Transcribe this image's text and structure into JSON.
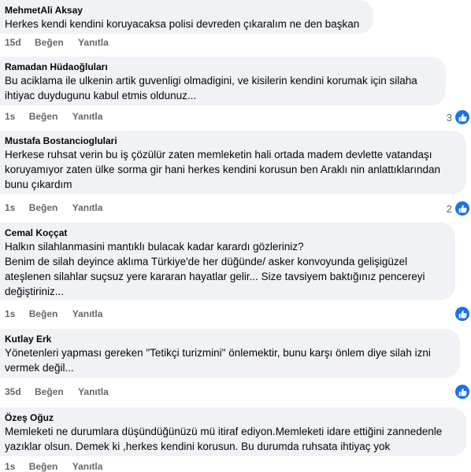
{
  "comments": [
    {
      "author": "MehmetAli Aksay",
      "lines": [
        "Herkes kendi kendini koruyacaksa polisi devreden çıkaralım ne den başkan"
      ],
      "time": "15d",
      "like_label": "Beğen",
      "reply_label": "Yanıtla",
      "reaction_count": ""
    },
    {
      "author": "Ramadan Hüdaoğluları",
      "lines": [
        "Bu aciklama ile ulkenin artik guvenligi olmadigini, ve kisilerin kendini korumak için silaha",
        "ihtiyac duydugunu kabul etmis oldunuz..."
      ],
      "time": "1s",
      "like_label": "Beğen",
      "reply_label": "Yanıtla",
      "reaction_count": "3"
    },
    {
      "author": "Mustafa Bostancioglulari",
      "lines": [
        "Herkese ruhsat verin bu iş çözülür zaten memleketin hali ortada madem devlette vatandaşı",
        "koruyamıyor zaten ülke sorma gir hani herkes kendini korusun ben Araklı nin anlattıklarından",
        "bunu çıkardım"
      ],
      "time": "1s",
      "like_label": "Beğen",
      "reply_label": "Yanıtla",
      "reaction_count": "2"
    },
    {
      "author": "Cemal Koççat",
      "lines": [
        "Halkın silahlanmasini mantıklı bulacak kadar karardı gözleriniz?",
        "Benim de silah deyince aklıma Türkiye'de her düğünde/ asker konvoyunda gelişigüzel",
        "ateşlenen silahlar suçsuz yere kararan hayatlar gelir... Size tavsiyem baktığınız pencereyi",
        "değiştiriniz..."
      ],
      "time": "1s",
      "like_label": "Beğen",
      "reply_label": "Yanıtla",
      "reaction_count": ""
    },
    {
      "author": "Kutlay Erk",
      "lines": [
        "Yönetenleri yapması gereken \"Tetikçi turizmini\" önlemektir, bunu karşı önlem diye silah izni",
        "vermek değil..."
      ],
      "time": "35d",
      "like_label": "Beğen",
      "reply_label": "Yanıtla",
      "reaction_count": ""
    },
    {
      "author": "Özeş Oğuz",
      "lines": [
        "Memleketi ne durumlara düşündüğünüzü mü itiraf ediyon.Memleketi idare ettiğini zannedenle",
        "yazıklar olsun. Demek ki ,herkes kendini korusun. Bu durumda ruhsata ihtiyaç yok"
      ],
      "time": "1s",
      "like_label": "Beğen",
      "reply_label": "Yanıtla",
      "reaction_count": ""
    }
  ],
  "colors": {
    "bubble": "#f0f2f5",
    "muted": "#65676b",
    "like": "#1b74e4"
  },
  "icons": {
    "reaction": "like-thumb-icon"
  }
}
